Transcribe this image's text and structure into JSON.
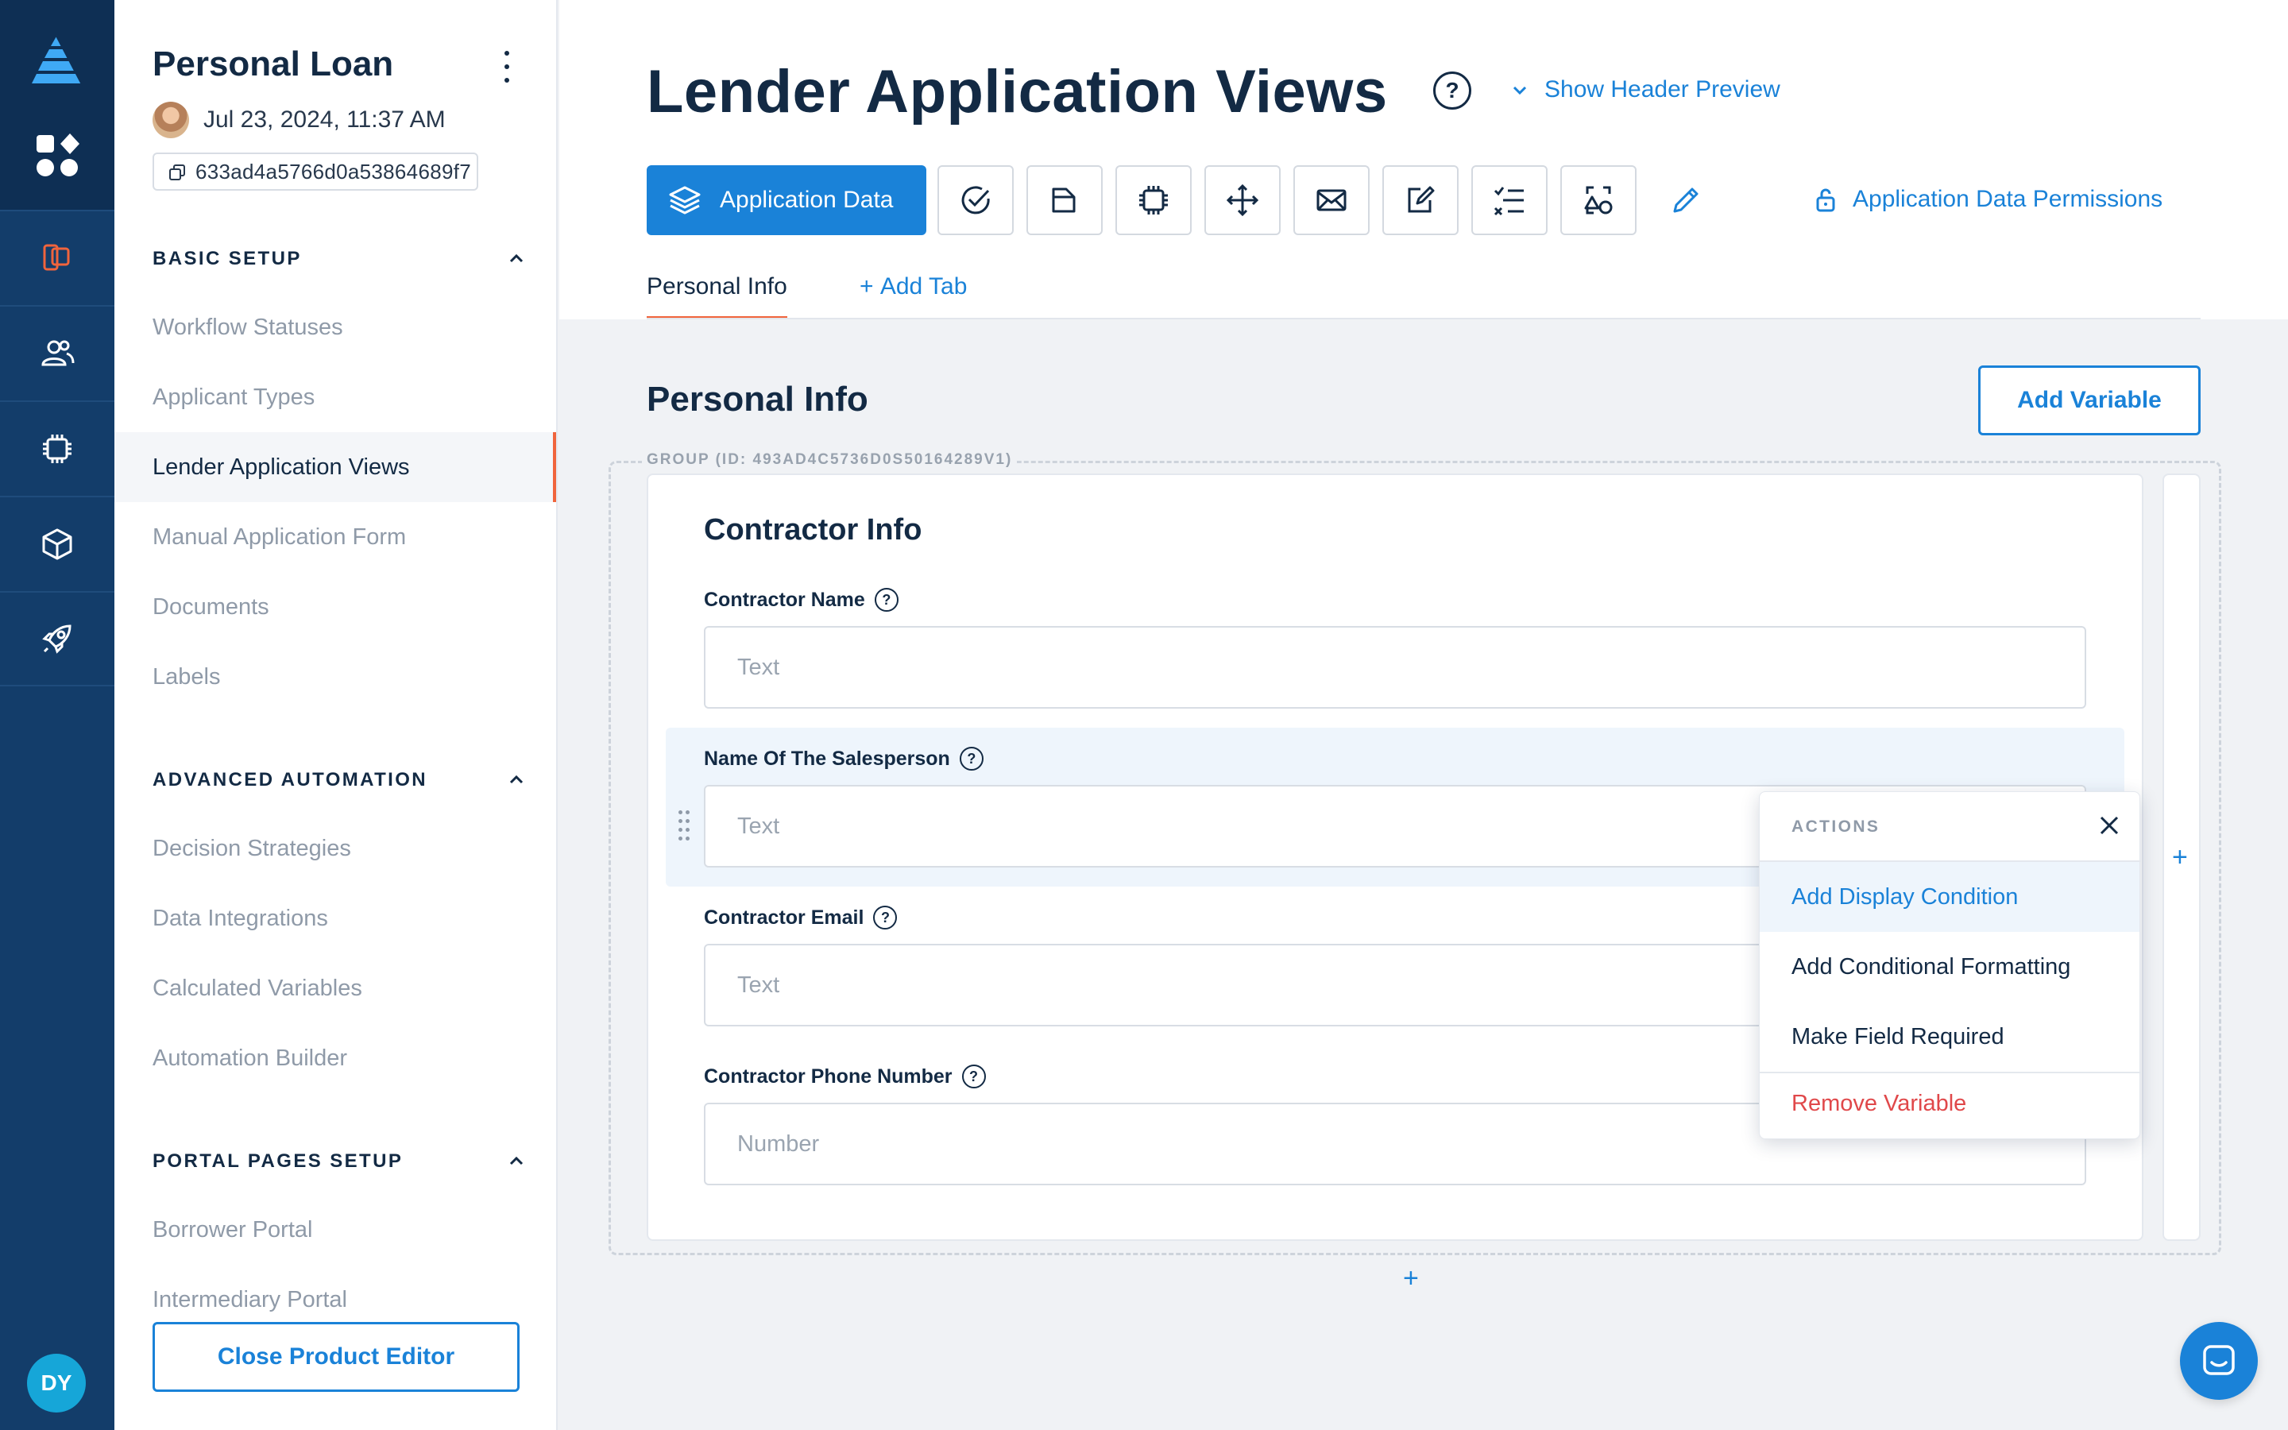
{
  "rail": {
    "avatar_initials": "DY",
    "items": [
      "product-icon",
      "users-icon",
      "chip-icon",
      "cube-icon",
      "rocket-icon"
    ]
  },
  "sidebar": {
    "title": "Personal Loan",
    "date": "Jul 23, 2024, 11:37 AM",
    "id": "633ad4a5766d0a53864689f7",
    "sections": [
      {
        "heading": "BASIC SETUP",
        "items": [
          "Workflow Statuses",
          "Applicant Types",
          "Lender Application Views",
          "Manual Application Form",
          "Documents",
          "Labels"
        ]
      },
      {
        "heading": "ADVANCED AUTOMATION",
        "items": [
          "Decision Strategies",
          "Data Integrations",
          "Calculated Variables",
          "Automation Builder"
        ]
      },
      {
        "heading": "PORTAL PAGES SETUP",
        "items": [
          "Borrower Portal",
          "Intermediary Portal"
        ]
      }
    ],
    "active_item": "Lender Application Views",
    "close_button": "Close Product Editor"
  },
  "header": {
    "title": "Lender Application Views",
    "help": "?",
    "show_preview": "Show Header Preview"
  },
  "toolbar": {
    "primary_label": "Application Data",
    "tools": [
      "check-circle-icon",
      "folder-icon",
      "chip-icon",
      "move-icon",
      "mail-icon",
      "edit-box-icon",
      "checklist-icon",
      "shapes-icon"
    ],
    "permissions": "Application Data Permissions"
  },
  "tabs": {
    "active": "Personal Info",
    "add": "Add Tab"
  },
  "section": {
    "title": "Personal Info",
    "add_variable": "Add Variable",
    "group_label": "GROUP (ID: 493AD4C5736D0S50164289V1)",
    "card_title": "Contractor Info",
    "fields": [
      {
        "label": "Contractor Name",
        "placeholder": "Text"
      },
      {
        "label": "Name Of The Salesperson",
        "placeholder": "Text"
      },
      {
        "label": "Contractor Email",
        "placeholder": "Text"
      },
      {
        "label": "Contractor Phone Number",
        "placeholder": "Number"
      }
    ]
  },
  "actions_menu": {
    "heading": "ACTIONS",
    "items": [
      "Add Display Condition",
      "Add Conditional Formatting",
      "Make Field Required"
    ],
    "danger_item": "Remove Variable"
  },
  "colors": {
    "rail": "#133d6a",
    "accent": "#1a82d8",
    "active_marker": "#f0643c",
    "danger": "#e0484a"
  }
}
